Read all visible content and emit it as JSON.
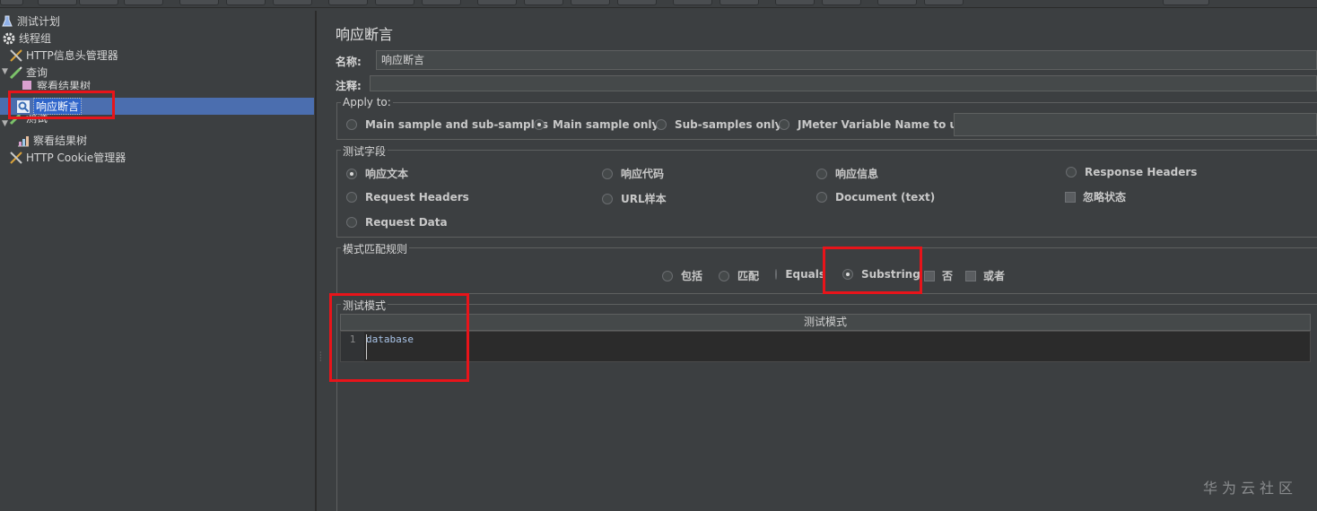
{
  "tree": {
    "items": [
      {
        "label": "测试计划",
        "icon": "flask-icon"
      },
      {
        "label": "线程组",
        "icon": "gear-icon"
      },
      {
        "label": "HTTP信息头管理器",
        "icon": "tools-icon"
      },
      {
        "label": "查询",
        "icon": "pipette-icon"
      },
      {
        "label": "察看结果树",
        "icon": "chart-icon"
      },
      {
        "label": "响应断言",
        "icon": "magnifier-icon"
      },
      {
        "label": "测试",
        "icon": "pipette-icon"
      },
      {
        "label": "察看结果树",
        "icon": "chart-icon"
      },
      {
        "label": "HTTP Cookie管理器",
        "icon": "tools-icon"
      }
    ]
  },
  "panel": {
    "title": "响应断言",
    "name_label": "名称:",
    "name_value": "响应断言",
    "comment_label": "注释:",
    "comment_value": ""
  },
  "apply_to": {
    "title": "Apply to:",
    "options": [
      "Main sample and sub-samples",
      "Main sample only",
      "Sub-samples only",
      "JMeter Variable Name to use"
    ],
    "selected": "Main sample only"
  },
  "test_field": {
    "title": "测试字段",
    "options": [
      "响应文本",
      "响应代码",
      "响应信息",
      "Response Headers",
      "Request Headers",
      "URL样本",
      "Document (text)",
      "Request Data"
    ],
    "ignore_status": "忽略状态",
    "selected": "响应文本"
  },
  "pattern_rules": {
    "title": "模式匹配规则",
    "options": [
      "包括",
      "匹配",
      "Equals",
      "Substring"
    ],
    "selected": "Substring",
    "not_label": "否",
    "or_label": "或者"
  },
  "test_patterns": {
    "title": "测试模式",
    "column_header": "测试模式",
    "line_number": "1",
    "value": "database"
  },
  "watermark": "华为云社区",
  "colors": {
    "highlight": "#e8141a",
    "selection": "#4b6eaf",
    "background": "#3c3f41"
  }
}
